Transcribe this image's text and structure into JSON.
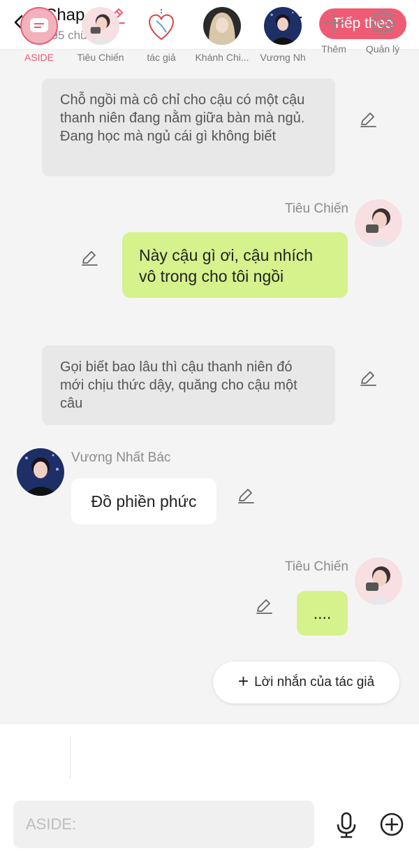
{
  "header": {
    "title": "Chap 3.",
    "word_count": "395 chữ",
    "next_label": "Tiếp theo",
    "accent": "#ef5b74"
  },
  "messages": [
    {
      "type": "narration",
      "text": "Chỗ ngồi mà cô chỉ cho cậu có một cậu thanh niên đang nằm giữa bàn mà ngủ. Đang học mà ngủ cái gì không biết"
    },
    {
      "type": "right",
      "speaker": "Tiêu Chiến",
      "text": "Này cậu gì ơi, cậu nhích vô trong cho tôi ngồi"
    },
    {
      "type": "narration",
      "text": "Gọi biết bao lâu thì cậu thanh niên đó mới chịu thức dậy, quăng cho cậu một câu"
    },
    {
      "type": "left",
      "speaker": "Vương Nhất Bác",
      "text": "Đồ phiền phức"
    },
    {
      "type": "right",
      "speaker": "Tiêu Chiến",
      "text": "...."
    }
  ],
  "author_note": {
    "label": "Lời nhắn của tác giả"
  },
  "characters": [
    {
      "label": "ASIDE"
    },
    {
      "label": "Tiêu Chiến"
    },
    {
      "label": "tác giả"
    },
    {
      "label": "Khánh Chi..."
    },
    {
      "label": "Vương Nh"
    },
    {
      "label": "Thêm"
    },
    {
      "label": "Quản lý"
    }
  ],
  "input": {
    "placeholder": "ASIDE:"
  },
  "colors": {
    "green_bubble": "#d6f28c",
    "narration_bg": "#e8e8e8",
    "background": "#f4f4f4"
  }
}
